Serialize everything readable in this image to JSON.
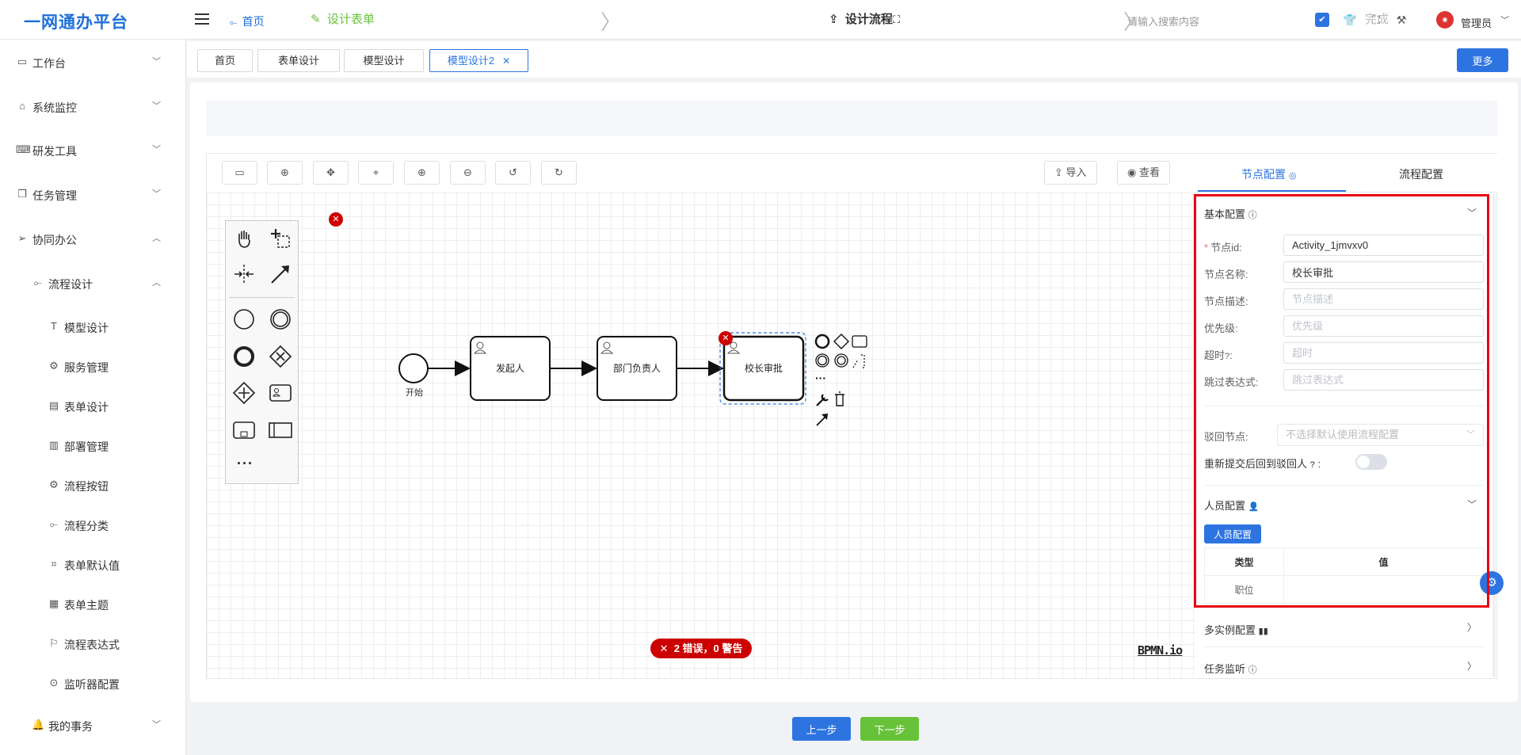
{
  "header": {
    "logo": "一网通办平台",
    "breadcrumb_home": "首页",
    "search_placeholder": "请输入搜索内容",
    "user_name": "管理员"
  },
  "sidebar": {
    "items": [
      {
        "label": "工作台",
        "icon": "monitor-icon"
      },
      {
        "label": "系统监控",
        "icon": "bank-icon"
      },
      {
        "label": "研发工具",
        "icon": "code-icon"
      },
      {
        "label": "任务管理",
        "icon": "copy-icon"
      },
      {
        "label": "协同办公",
        "icon": "send-icon"
      },
      {
        "label": "流程设计",
        "icon": "share-icon"
      },
      {
        "label": "模型设计",
        "icon": "text-icon"
      },
      {
        "label": "服务管理",
        "icon": "gear-icon"
      },
      {
        "label": "表单设计",
        "icon": "form-icon"
      },
      {
        "label": "部署管理",
        "icon": "chart-icon"
      },
      {
        "label": "流程按钮",
        "icon": "gear-icon"
      },
      {
        "label": "流程分类",
        "icon": "share-icon"
      },
      {
        "label": "表单默认值",
        "icon": "tag-icon"
      },
      {
        "label": "表单主题",
        "icon": "calendar-icon"
      },
      {
        "label": "流程表达式",
        "icon": "flag-icon"
      },
      {
        "label": "监听器配置",
        "icon": "toggle-icon"
      },
      {
        "label": "我的事务",
        "icon": "bell-icon"
      }
    ]
  },
  "tabs": [
    {
      "label": "首页"
    },
    {
      "label": "表单设计"
    },
    {
      "label": "模型设计"
    },
    {
      "label": "模型设计2"
    }
  ],
  "more_button": "更多",
  "steps": {
    "step1": "设计表单",
    "step2": "设计流程",
    "step3": "完成"
  },
  "toolbar": {
    "import_label": "导入",
    "view_label": "查看"
  },
  "diagram": {
    "start_label": "开始",
    "task1": "发起人",
    "task2": "部门负责人",
    "task3": "校长审批"
  },
  "status": {
    "errors": "2 错误，0 警告",
    "bpmn_logo": "BPMN.io"
  },
  "config": {
    "tab_node": "节点配置",
    "tab_process": "流程配置",
    "basic_section": "基本配置",
    "fields": [
      {
        "label": "节点id:",
        "value": "Activity_1jmvxv0",
        "placeholder": "",
        "required": true
      },
      {
        "label": "节点名称:",
        "value": "校长审批",
        "placeholder": ""
      },
      {
        "label": "节点描述:",
        "value": "",
        "placeholder": "节点描述"
      },
      {
        "label": "优先级:",
        "value": "",
        "placeholder": "优先级"
      },
      {
        "label": "超时",
        "value": "",
        "placeholder": "超时"
      },
      {
        "label": "跳过表达式:",
        "value": "",
        "placeholder": "跳过表达式"
      }
    ],
    "reject_label": "驳回节点:",
    "reject_placeholder": "不选择默认使用流程配置",
    "resubmit_label": "重新提交后回到驳回人",
    "people_section": "人员配置",
    "people_button": "人员配置",
    "table_headers": [
      "类型",
      "值"
    ],
    "table_rows": [
      [
        "职位",
        ""
      ]
    ],
    "multi_instance": "多实例配置",
    "task_listener": "任务监听"
  },
  "bottom": {
    "prev": "上一步",
    "next": "下一步"
  },
  "colors": {
    "primary": "#2d74e0",
    "success": "#67c23a",
    "danger": "#cc0000",
    "highlight": "#e60012"
  }
}
